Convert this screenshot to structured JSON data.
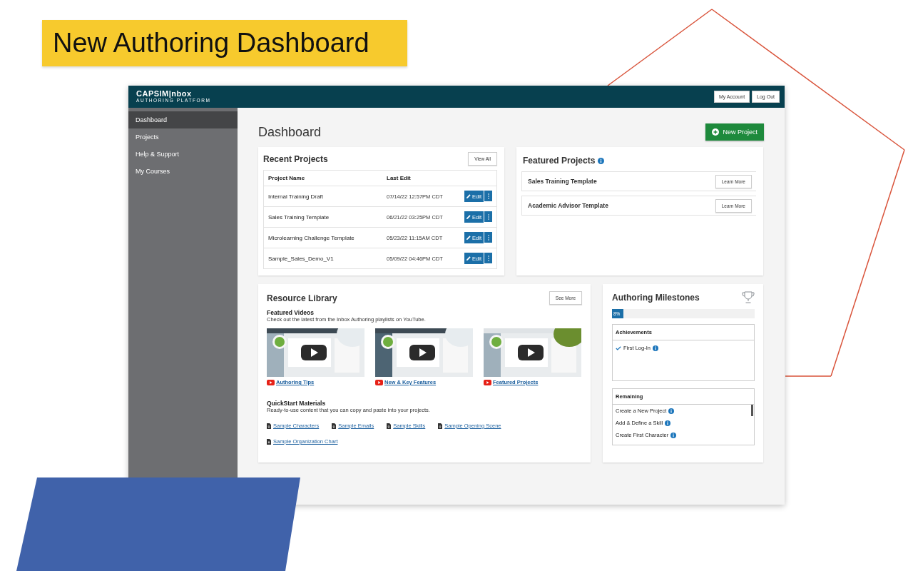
{
  "slide": {
    "title": "New Authoring Dashboard"
  },
  "header": {
    "logo": "CAPSIM|nbox",
    "logo_subtitle": "AUTHORING PLATFORM",
    "buttons": [
      "My Account",
      "Log Out"
    ]
  },
  "sidebar": {
    "items": [
      {
        "label": "Dashboard",
        "selected": true
      },
      {
        "label": "Projects",
        "selected": false
      },
      {
        "label": "Help & Support",
        "selected": false
      },
      {
        "label": "My Courses",
        "selected": false
      }
    ]
  },
  "page": {
    "title": "Dashboard",
    "new_project": "New Project"
  },
  "recent_projects": {
    "title": "Recent Projects",
    "view_all": "View All",
    "columns": [
      "Project Name",
      "Last Edit"
    ],
    "rows": [
      {
        "name": "Internal Training Draft",
        "last_edit": "07/14/22 12:57PM CDT",
        "edit": "Edit"
      },
      {
        "name": "Sales Training Template",
        "last_edit": "06/21/22 03:25PM CDT",
        "edit": "Edit"
      },
      {
        "name": "Microlearning Challenge Template",
        "last_edit": "05/23/22 11:15AM CDT",
        "edit": "Edit"
      },
      {
        "name": "Sample_Sales_Demo_V1",
        "last_edit": "05/09/22 04:46PM CDT",
        "edit": "Edit"
      }
    ]
  },
  "featured_projects": {
    "title": "Featured Projects",
    "items": [
      {
        "name": "Sales Training Template",
        "button": "Learn More"
      },
      {
        "name": "Academic Advisor Template",
        "button": "Learn More"
      }
    ]
  },
  "resource_library": {
    "title": "Resource Library",
    "see_more": "See More",
    "videos_heading": "Featured Videos",
    "videos_text": "Check out the latest from the Inbox Authoring playlists on YouTube.",
    "videos": [
      {
        "kind": "picture",
        "link": "Authoring Tips"
      },
      {
        "kind": "picture",
        "link": "New & Key Features"
      },
      {
        "kind": "picture",
        "link": "Featured Projects"
      }
    ],
    "materials_heading": "QuickStart Materials",
    "materials_text": "Ready-to-use content that you can copy and paste into your projects.",
    "materials": [
      "Sample Characters",
      "Sample Emails",
      "Sample Skills",
      "Sample Opening Scene",
      "Sample Organization Chart"
    ]
  },
  "milestones": {
    "title": "Authoring Milestones",
    "level": 0.08,
    "reading": "8%",
    "achievements_title": "Achievements",
    "achievements": [
      "First Log-In"
    ],
    "remaining_title": "Remaining",
    "remaining": [
      "Create a New Project",
      "Add & Define a Skill",
      "Create First Character"
    ]
  }
}
